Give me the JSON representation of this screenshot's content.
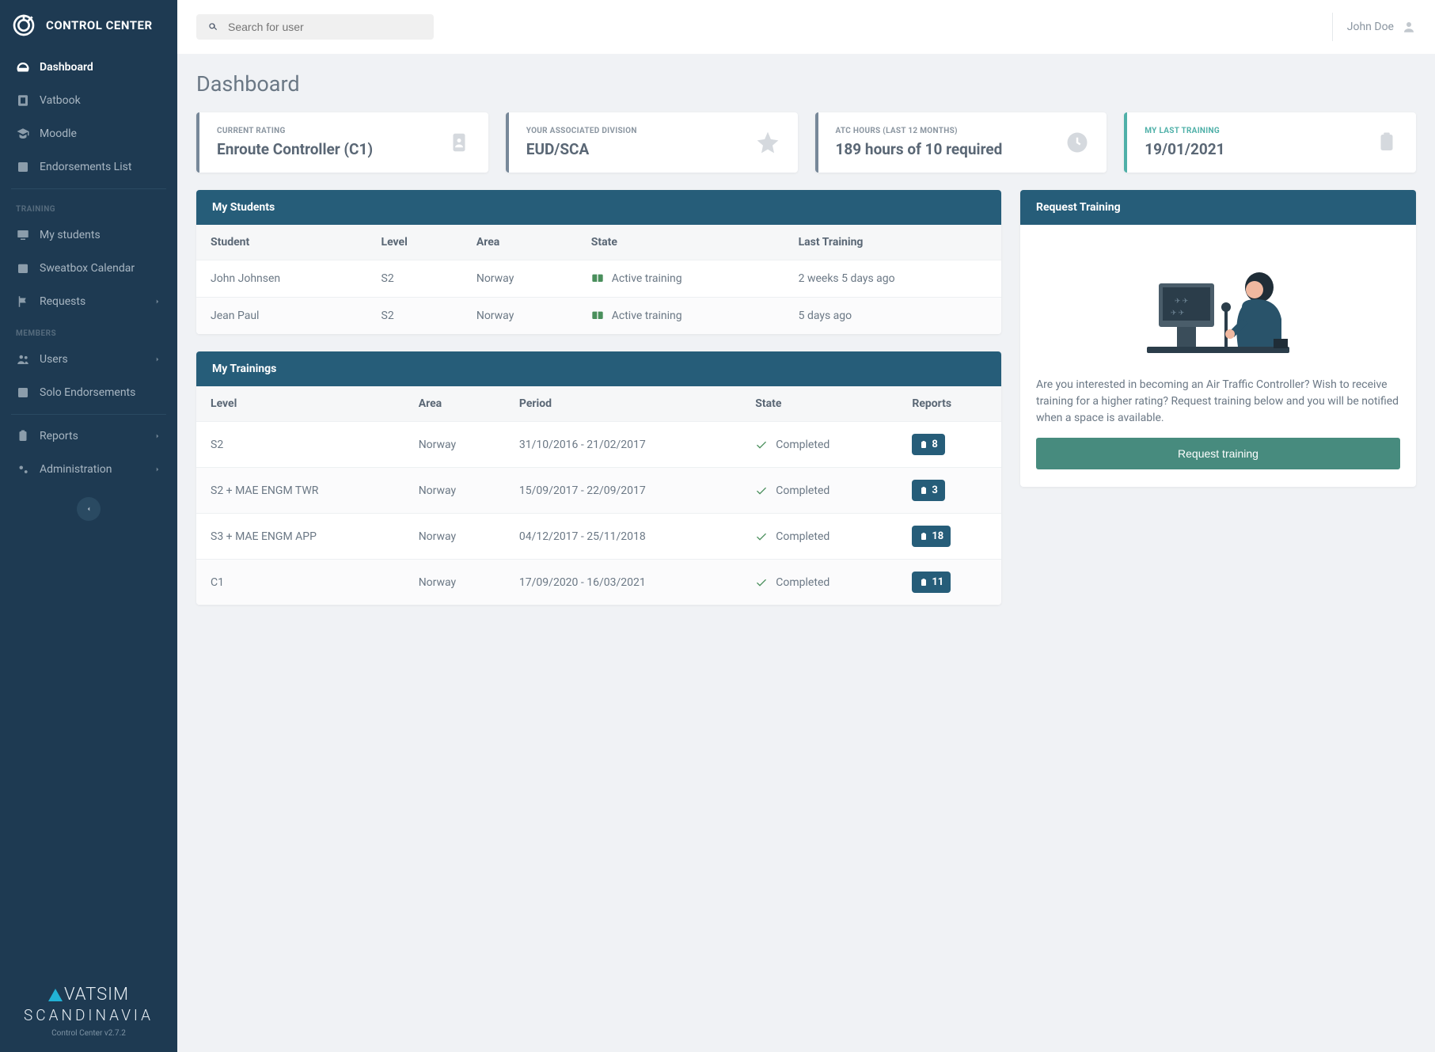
{
  "brand": {
    "title": "CONTROL CENTER"
  },
  "sidebar": {
    "items": [
      {
        "label": "Dashboard",
        "active": true
      },
      {
        "label": "Vatbook"
      },
      {
        "label": "Moodle"
      },
      {
        "label": "Endorsements List"
      }
    ],
    "training_section": "TRAINING",
    "training_items": [
      {
        "label": "My students"
      },
      {
        "label": "Sweatbox Calendar"
      },
      {
        "label": "Requests",
        "expandable": true
      }
    ],
    "members_section": "MEMBERS",
    "members_items": [
      {
        "label": "Users",
        "expandable": true
      },
      {
        "label": "Solo Endorsements"
      }
    ],
    "bottom_items": [
      {
        "label": "Reports",
        "expandable": true
      },
      {
        "label": "Administration",
        "expandable": true
      }
    ],
    "footer": {
      "brand1": "VATSIM",
      "brand2": "SCANDINAVIA",
      "version": "Control Center v2.7.2"
    }
  },
  "topbar": {
    "search_placeholder": "Search for user",
    "user_name": "John Doe"
  },
  "page": {
    "title": "Dashboard"
  },
  "cards": [
    {
      "label": "CURRENT RATING",
      "value": "Enroute Controller (C1)"
    },
    {
      "label": "YOUR ASSOCIATED DIVISION",
      "value": "EUD/SCA"
    },
    {
      "label": "ATC HOURS (LAST 12 MONTHS)",
      "value": "189 hours of 10 required"
    },
    {
      "label": "MY LAST TRAINING",
      "value": "19/01/2021",
      "accent": true
    }
  ],
  "my_students": {
    "title": "My Students",
    "columns": [
      "Student",
      "Level",
      "Area",
      "State",
      "Last Training"
    ],
    "rows": [
      {
        "student": "John Johnsen",
        "level": "S2",
        "area": "Norway",
        "state": "Active training",
        "last": "2 weeks 5 days ago"
      },
      {
        "student": "Jean Paul",
        "level": "S2",
        "area": "Norway",
        "state": "Active training",
        "last": "5 days ago"
      }
    ]
  },
  "my_trainings": {
    "title": "My Trainings",
    "columns": [
      "Level",
      "Area",
      "Period",
      "State",
      "Reports"
    ],
    "rows": [
      {
        "level": "S2",
        "area": "Norway",
        "period": "31/10/2016 - 21/02/2017",
        "state": "Completed",
        "reports": "8"
      },
      {
        "level": "S2 + MAE ENGM TWR",
        "area": "Norway",
        "period": "15/09/2017 - 22/09/2017",
        "state": "Completed",
        "reports": "3"
      },
      {
        "level": "S3 + MAE ENGM APP",
        "area": "Norway",
        "period": "04/12/2017 - 25/11/2018",
        "state": "Completed",
        "reports": "18"
      },
      {
        "level": "C1",
        "area": "Norway",
        "period": "17/09/2020 - 16/03/2021",
        "state": "Completed",
        "reports": "11"
      }
    ]
  },
  "request": {
    "title": "Request Training",
    "text": "Are you interested in becoming an Air Traffic Controller? Wish to receive training for a higher rating? Request training below and you will be notified when a space is available.",
    "button": "Request training"
  }
}
